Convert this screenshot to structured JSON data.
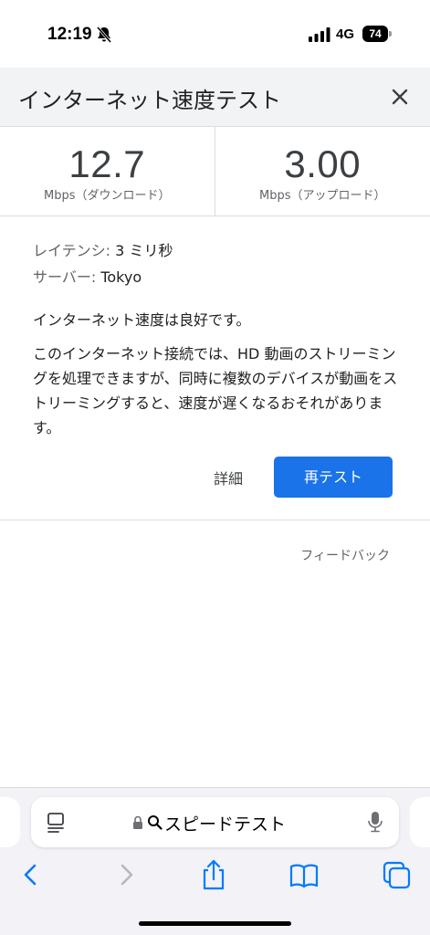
{
  "status": {
    "time": "12:19",
    "network": "4G",
    "battery": "74"
  },
  "header": {
    "title": "インターネット速度テスト"
  },
  "speeds": {
    "download_value": "12.7",
    "download_unit": "Mbps（ダウンロード）",
    "upload_value": "3.00",
    "upload_unit": "Mbps（アップロード）"
  },
  "info": {
    "latency_label": "レイテンシ:",
    "latency_value": "3 ミリ秒",
    "server_label": "サーバー:",
    "server_value": "Tokyo",
    "summary": "インターネット速度は良好です。",
    "description": "このインターネット接続では、HD 動画のストリーミングを処理できますが、同時に複数のデバイスが動画をストリーミングすると、速度が遅くなるおそれがあります。",
    "details_label": "詳細",
    "retest_label": "再テスト"
  },
  "feedback_label": "フィードバック",
  "browser": {
    "address_text": "スピードテスト"
  },
  "colors": {
    "accent": "#1a73e8",
    "header_bg": "#f1f3f4",
    "ios_blue": "#007aff"
  }
}
